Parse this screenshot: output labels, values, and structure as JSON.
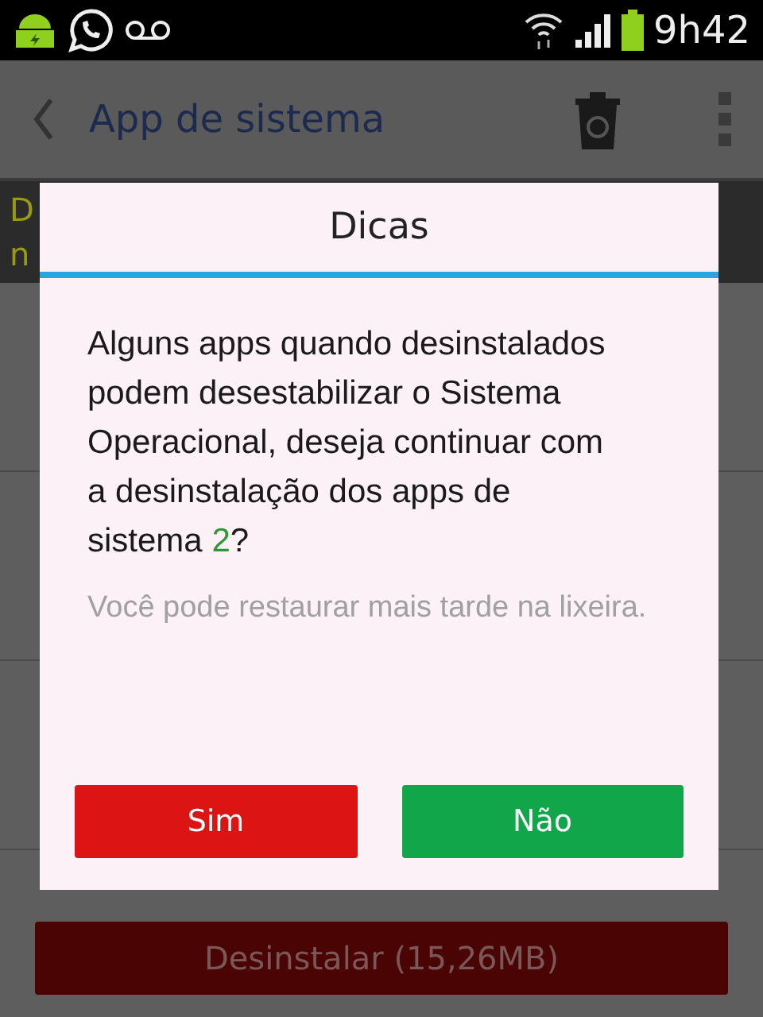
{
  "status_bar": {
    "time": "9h42"
  },
  "app_bar": {
    "title": "App de sistema"
  },
  "banner": {
    "lines": [
      "D",
      "n"
    ]
  },
  "bottom_button": {
    "label": "Desinstalar (15,26MB)"
  },
  "dialog": {
    "title": "Dicas",
    "message": "Alguns apps quando desinstalados podem desestabilizar o Sistema Operacional, deseja continuar com a desinstalação dos apps de sistema ",
    "count": "2",
    "message_end": "?",
    "note": "Você pode restaurar mais tarde na lixeira.",
    "buttons": [
      {
        "label": "Sim",
        "kind": "confirm"
      },
      {
        "label": "Não",
        "kind": "cancel"
      }
    ]
  }
}
